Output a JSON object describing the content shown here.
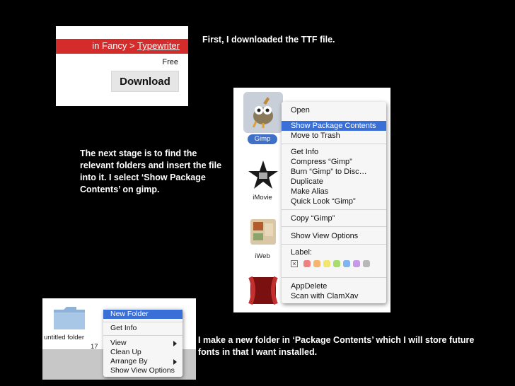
{
  "captions": {
    "first": "First, I downloaded the TTF file.",
    "second": "The next stage is to find the relevant folders and insert the file into it. I select ‘Show Package Contents’ on gimp.",
    "third": "I make a new folder in ‘Package Contents’ which I will store future fonts in that I want installed."
  },
  "download_panel": {
    "breadcrumb_prefix": "in Fancy >",
    "breadcrumb_link": "Typewriter",
    "price": "Free",
    "download_label": "Download",
    "colors": {
      "bar": "#d42b2b",
      "button": "#e6e6e6"
    }
  },
  "finder_panel": {
    "apps": [
      {
        "name": "Gimp",
        "icon": "gimp-icon",
        "selected": true
      },
      {
        "name": "iMovie",
        "icon": "imovie-icon"
      },
      {
        "name": "iWeb",
        "icon": "iweb-icon"
      },
      {
        "name": "",
        "icon": "theater-icon"
      }
    ],
    "context_menu": [
      {
        "label": "Open"
      },
      {
        "label": "Show Package Contents",
        "highlighted": true
      },
      {
        "label": "Move to Trash"
      },
      {
        "label": "Get Info"
      },
      {
        "label": "Compress “Gimp”"
      },
      {
        "label": "Burn “Gimp” to Disc…"
      },
      {
        "label": "Duplicate"
      },
      {
        "label": "Make Alias"
      },
      {
        "label": "Quick Look “Gimp”"
      },
      {
        "label": "Copy “Gimp”"
      },
      {
        "label": "Show View Options"
      },
      {
        "label": "Label:"
      },
      {
        "label": "AppDelete"
      },
      {
        "label": "Scan with ClamXav"
      }
    ],
    "label_colors": [
      "#f08080",
      "#f5b56b",
      "#f2e56b",
      "#a8dd6b",
      "#7fb6f0",
      "#c69ae8",
      "#b8b8b8"
    ],
    "highlight_color": "#3a6fd8"
  },
  "folder_panel": {
    "folder_name": "untitled folder",
    "count": "17",
    "context_menu": [
      {
        "label": "New Folder",
        "highlighted": true
      },
      {
        "label": "Get Info"
      },
      {
        "label": "View",
        "submenu": true
      },
      {
        "label": "Clean Up"
      },
      {
        "label": "Arrange By",
        "submenu": true
      },
      {
        "label": "Show View Options"
      }
    ]
  }
}
